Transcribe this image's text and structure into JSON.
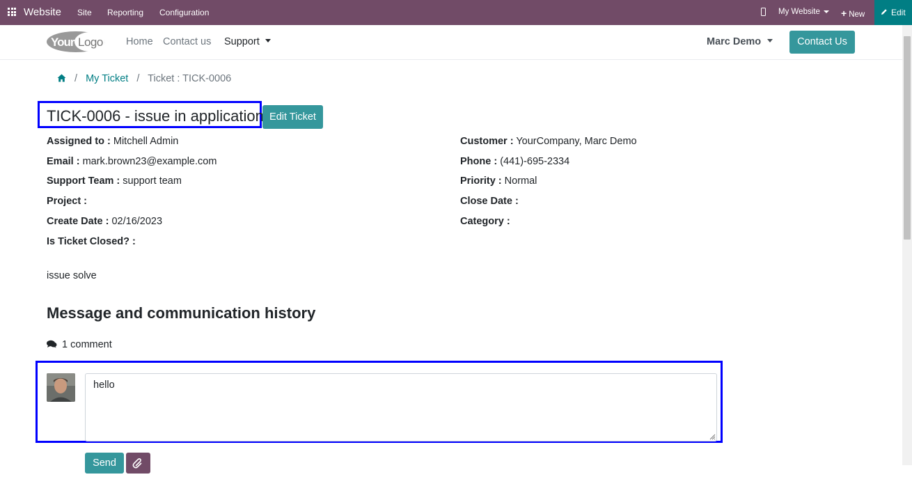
{
  "adminbar": {
    "brand": "Website",
    "menu": [
      "Site",
      "Reporting",
      "Configuration"
    ],
    "my_website": "My Website",
    "new_label": "New",
    "edit_label": "Edit"
  },
  "header": {
    "logo_text": "YourLogo",
    "nav": [
      "Home",
      "Contact us",
      "Support"
    ],
    "user": "Marc Demo",
    "contact_button": "Contact Us"
  },
  "breadcrumb": {
    "items": [
      "My Ticket",
      "Ticket : TICK-0006"
    ]
  },
  "ticket": {
    "title": "TICK-0006 - issue in application",
    "edit_button": "Edit Ticket",
    "left_fields": [
      {
        "label": "Assigned to :",
        "value": "Mitchell Admin"
      },
      {
        "label": "Email :",
        "value": "mark.brown23@example.com"
      },
      {
        "label": "Support Team :",
        "value": "support team"
      },
      {
        "label": "Project :",
        "value": ""
      },
      {
        "label": "Create Date :",
        "value": "02/16/2023"
      },
      {
        "label": "Is Ticket Closed? :",
        "value": ""
      }
    ],
    "right_fields": [
      {
        "label": "Customer :",
        "value": "YourCompany, Marc Demo"
      },
      {
        "label": "Phone :",
        "value": "(441)-695-2334"
      },
      {
        "label": "Priority :",
        "value": "Normal"
      },
      {
        "label": "Close Date :",
        "value": ""
      },
      {
        "label": "Category :",
        "value": ""
      }
    ],
    "description": "issue solve"
  },
  "messages": {
    "section_title": "Message and communication history",
    "comment_count": "1 comment",
    "input_value": "hello ",
    "send_label": "Send"
  },
  "colors": {
    "admin_bar": "#714b67",
    "edit_bg": "#017e84",
    "primary_btn": "#35979c",
    "highlight_border": "#0000ff"
  }
}
